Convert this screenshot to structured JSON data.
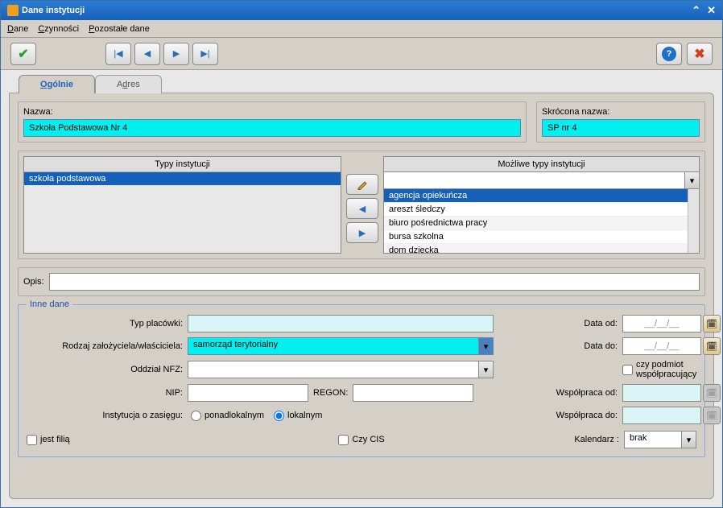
{
  "window": {
    "title": "Dane instytucji"
  },
  "menu": {
    "dane": "Dane",
    "czynnosci": "Czynności",
    "pozostale": "Pozostałe dane"
  },
  "tabs": {
    "ogolnie": "Ogólnie",
    "adres": "Adres"
  },
  "name_section": {
    "nazwa_label": "Nazwa:",
    "nazwa_value": "Szkoła Podstawowa Nr 4",
    "skrocona_label": "Skrócona nazwa:",
    "skrocona_value": "SP nr 4"
  },
  "types": {
    "left_header": "Typy instytucji",
    "left_items": [
      "szkoła podstawowa"
    ],
    "right_header": "Możliwe typy instytucji",
    "options": [
      "agencja opiekuńcza",
      "areszt śledczy",
      "biuro pośrednictwa pracy",
      "bursa szkolna",
      "dom dziecka"
    ]
  },
  "opis": {
    "label": "Opis:",
    "value": ""
  },
  "inne": {
    "legend": "Inne dane",
    "typ_placowki_label": "Typ placówki:",
    "typ_placowki_value": "",
    "rodzaj_label": "Rodzaj założyciela/właściciela:",
    "rodzaj_value": "samorząd terytorialny",
    "oddzial_label": "Oddział NFZ:",
    "oddzial_value": "",
    "nip_label": "NIP:",
    "nip_value": "",
    "regon_label": "REGON:",
    "regon_value": "",
    "zasieg_label": "Instytucja o zasięgu:",
    "zasieg_ponad": "ponadlokalnym",
    "zasieg_lokal": "lokalnym",
    "data_od_label": "Data od:",
    "data_od_value": "__/__/__",
    "data_do_label": "Data do:",
    "data_do_value": "__/__/__",
    "czy_podmiot": "czy podmiot współpracujący",
    "wspolpraca_od_label": "Współpraca od:",
    "wspolpraca_od_value": "",
    "wspolpraca_do_label": "Współpraca do:",
    "wspolpraca_do_value": "",
    "jest_filia": "jest filią",
    "czy_cis": "Czy CIS",
    "kalendarz_label": "Kalendarz :",
    "kalendarz_value": "brak"
  }
}
